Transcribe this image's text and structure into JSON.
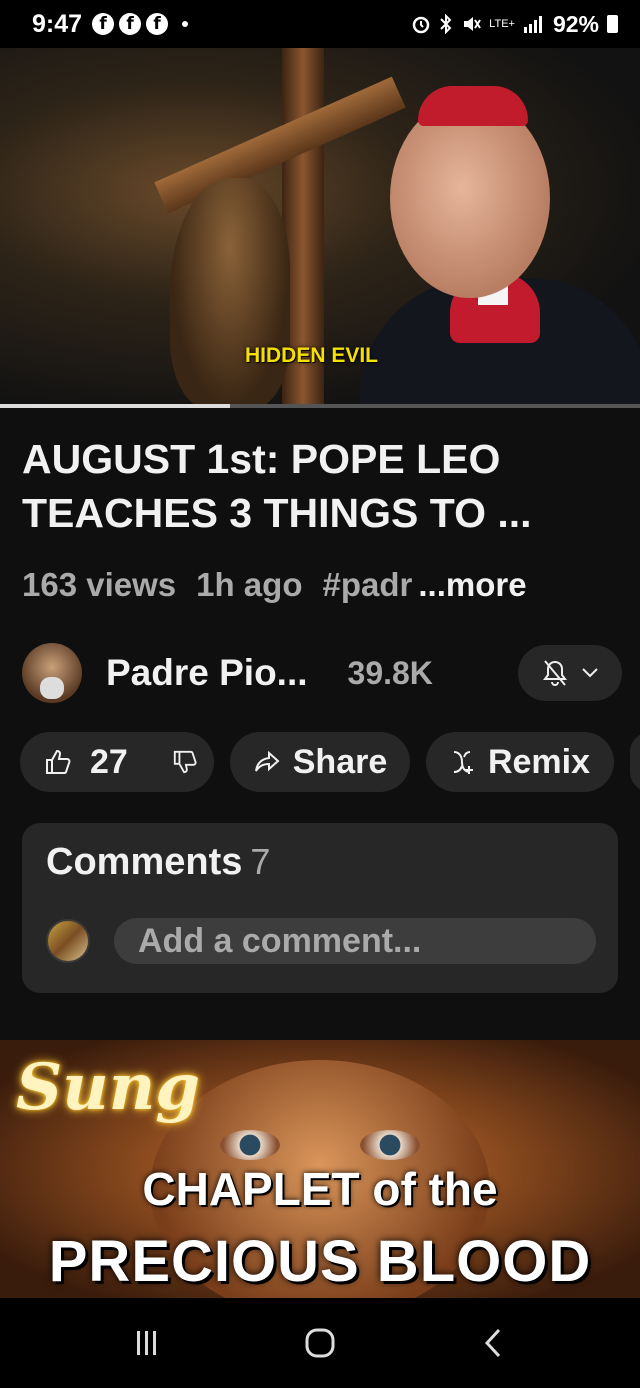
{
  "status_bar": {
    "time": "9:47",
    "notification_icons": [
      "facebook-icon",
      "facebook-icon",
      "facebook-icon"
    ],
    "network": "LTE+",
    "battery": "92%"
  },
  "video": {
    "overlay_caption": "HIDDEN EVIL",
    "progress": 0.36
  },
  "details": {
    "title": "AUGUST 1st: POPE LEO TEACHES 3 THINGS TO ...",
    "views": "163 views",
    "age": "1h ago",
    "hashtag": "#padr",
    "more": "...more"
  },
  "channel": {
    "name": "Padre Pio...",
    "subscribers": "39.8K"
  },
  "actions": {
    "likes": "27",
    "share": "Share",
    "remix": "Remix"
  },
  "comments": {
    "heading": "Comments",
    "count": "7",
    "placeholder": "Add a comment..."
  },
  "next_video": {
    "script_word": "Sung",
    "line1": "CHAPLET of the",
    "line2": "PRECIOUS BLOOD"
  },
  "colors": {
    "background": "#0f0f0f",
    "surface": "#272727",
    "caption_yellow": "#f5e000"
  }
}
